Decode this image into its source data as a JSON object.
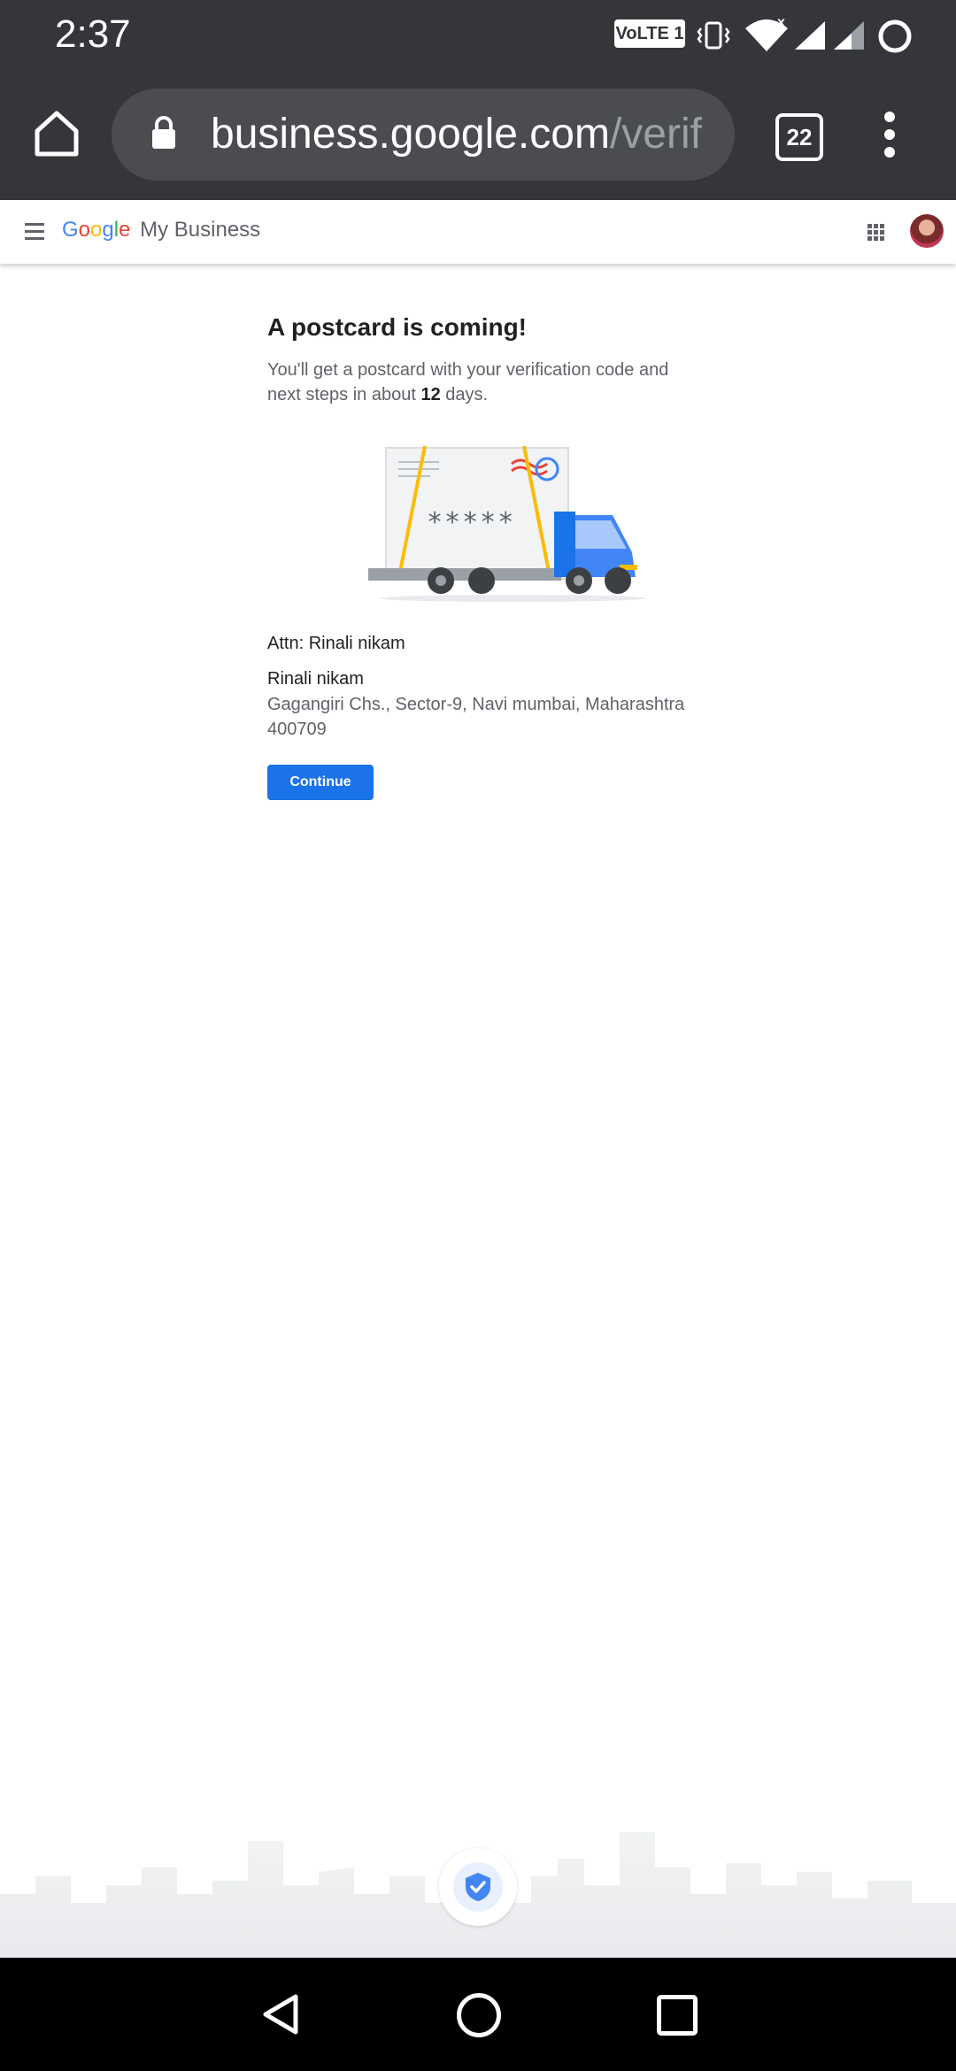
{
  "status_bar": {
    "time": "2:37",
    "network_badge": "VoLTE 1",
    "icons": [
      "vibrate-icon",
      "wifi-icon",
      "signal-icon",
      "signal-icon",
      "battery-ring-icon"
    ]
  },
  "browser": {
    "url_domain": "business.google.com",
    "url_path": "/verif",
    "tab_count": "22"
  },
  "gmb_header": {
    "logo_letters": [
      "G",
      "o",
      "o",
      "g",
      "l",
      "e"
    ],
    "product_name": "My Business"
  },
  "main": {
    "title": "A postcard is coming!",
    "desc_prefix": "You'll get a postcard with your verification code and next steps in about ",
    "desc_days": "12",
    "desc_suffix": " days.",
    "postcard_code_mask": "*****",
    "attn": "Attn: Rinali nikam",
    "recipient_name": "Rinali nikam",
    "address": "Gagangiri Chs., Sector-9, Navi mumbai, Maharashtra 400709",
    "continue_label": "Continue"
  },
  "colors": {
    "chrome_dark": "#35363a",
    "accent_blue": "#1a73e8",
    "google_blue": "#4285f4",
    "google_red": "#ea4335",
    "google_yellow": "#fbbc05",
    "google_green": "#34a853"
  }
}
